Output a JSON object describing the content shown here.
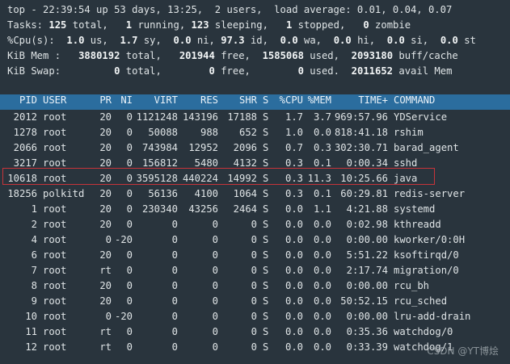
{
  "summary": {
    "line1": "top - 22:39:54 up 53 days, 13:25,  2 users,  load average: 0.01, 0.04, 0.07",
    "tasks": {
      "label": "Tasks:",
      "total": "125",
      "total_l": "total,",
      "running": "1",
      "running_l": "running,",
      "sleeping": "123",
      "sleeping_l": "sleeping,",
      "stopped": "1",
      "stopped_l": "stopped,",
      "zombie": "0",
      "zombie_l": "zombie"
    },
    "cpu": {
      "label": "%Cpu(s):",
      "us": "1.0",
      "us_l": "us,",
      "sy": "1.7",
      "sy_l": "sy,",
      "ni": "0.0",
      "ni_l": "ni,",
      "id": "97.3",
      "id_l": "id,",
      "wa": "0.0",
      "wa_l": "wa,",
      "hi": "0.0",
      "hi_l": "hi,",
      "si": "0.0",
      "si_l": "si,",
      "st": "0.0",
      "st_l": "st"
    },
    "mem": {
      "label": "KiB Mem :",
      "total": "3880192",
      "total_l": "total,",
      "free": "201944",
      "free_l": "free,",
      "used": "1585068",
      "used_l": "used,",
      "buff": "2093180",
      "buff_l": "buff/cache"
    },
    "swap": {
      "label": "KiB Swap:",
      "total": "0",
      "total_l": "total,",
      "free": "0",
      "free_l": "free,",
      "used": "0",
      "used_l": "used.",
      "avail": "2011652",
      "avail_l": "avail Mem"
    }
  },
  "columns": [
    "PID",
    "USER",
    "PR",
    "NI",
    "VIRT",
    "RES",
    "SHR",
    "S",
    "%CPU",
    "%MEM",
    "TIME+",
    "COMMAND"
  ],
  "processes": [
    [
      "2012",
      "root",
      "20",
      "0",
      "1121248",
      "143196",
      "17188",
      "S",
      "1.7",
      "3.7",
      "969:57.96",
      "YDService"
    ],
    [
      "1278",
      "root",
      "20",
      "0",
      "50088",
      "988",
      "652",
      "S",
      "1.0",
      "0.0",
      "818:41.18",
      "rshim"
    ],
    [
      "2066",
      "root",
      "20",
      "0",
      "743984",
      "12952",
      "2096",
      "S",
      "0.7",
      "0.3",
      "302:30.71",
      "barad_agent"
    ],
    [
      "3217",
      "root",
      "20",
      "0",
      "156812",
      "5480",
      "4132",
      "S",
      "0.3",
      "0.1",
      "0:00.34",
      "sshd"
    ],
    [
      "10618",
      "root",
      "20",
      "0",
      "3595128",
      "440224",
      "14992",
      "S",
      "0.3",
      "11.3",
      "10:25.66",
      "java"
    ],
    [
      "18256",
      "polkitd",
      "20",
      "0",
      "56136",
      "4100",
      "1064",
      "S",
      "0.3",
      "0.1",
      "60:29.81",
      "redis-server"
    ],
    [
      "1",
      "root",
      "20",
      "0",
      "230340",
      "43256",
      "2464",
      "S",
      "0.0",
      "1.1",
      "4:21.88",
      "systemd"
    ],
    [
      "2",
      "root",
      "20",
      "0",
      "0",
      "0",
      "0",
      "S",
      "0.0",
      "0.0",
      "0:02.98",
      "kthreadd"
    ],
    [
      "4",
      "root",
      "0",
      "-20",
      "0",
      "0",
      "0",
      "S",
      "0.0",
      "0.0",
      "0:00.00",
      "kworker/0:0H"
    ],
    [
      "6",
      "root",
      "20",
      "0",
      "0",
      "0",
      "0",
      "S",
      "0.0",
      "0.0",
      "5:51.22",
      "ksoftirqd/0"
    ],
    [
      "7",
      "root",
      "rt",
      "0",
      "0",
      "0",
      "0",
      "S",
      "0.0",
      "0.0",
      "2:17.74",
      "migration/0"
    ],
    [
      "8",
      "root",
      "20",
      "0",
      "0",
      "0",
      "0",
      "S",
      "0.0",
      "0.0",
      "0:00.00",
      "rcu_bh"
    ],
    [
      "9",
      "root",
      "20",
      "0",
      "0",
      "0",
      "0",
      "S",
      "0.0",
      "0.0",
      "50:52.15",
      "rcu_sched"
    ],
    [
      "10",
      "root",
      "0",
      "-20",
      "0",
      "0",
      "0",
      "S",
      "0.0",
      "0.0",
      "0:00.00",
      "lru-add-drain"
    ],
    [
      "11",
      "root",
      "rt",
      "0",
      "0",
      "0",
      "0",
      "S",
      "0.0",
      "0.0",
      "0:35.36",
      "watchdog/0"
    ],
    [
      "12",
      "root",
      "rt",
      "0",
      "0",
      "0",
      "0",
      "S",
      "0.0",
      "0.0",
      "0:33.39",
      "watchdog/1"
    ]
  ],
  "highlighted_pid": "10618",
  "watermark": "CSDN @YT博烩"
}
